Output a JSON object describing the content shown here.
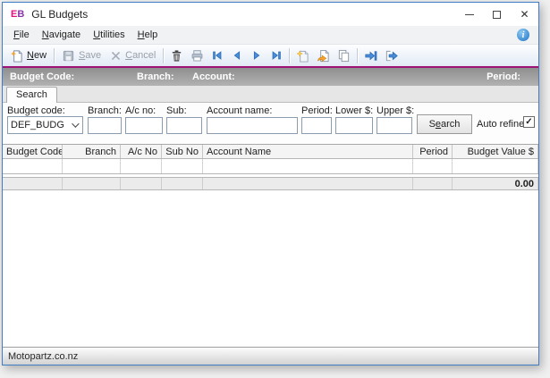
{
  "window": {
    "title": "GL Budgets",
    "logo_e": "E",
    "logo_b": "B"
  },
  "icons": {
    "close": "✕",
    "info": "i",
    "checkbox_check": "✓",
    "toolbar_icon_names": [
      "new-page",
      "save-disk",
      "cancel-x",
      "delete-trash",
      "print",
      "nav-first",
      "nav-previous",
      "nav-next",
      "nav-last",
      "new-line",
      "edit-line",
      "copy-pages",
      "import-arrow",
      "export-arrow"
    ]
  },
  "menu": {
    "items": [
      {
        "pre": "",
        "key": "F",
        "post": "ile"
      },
      {
        "pre": "",
        "key": "N",
        "post": "avigate"
      },
      {
        "pre": "",
        "key": "U",
        "post": "tilities"
      },
      {
        "pre": "",
        "key": "H",
        "post": "elp"
      }
    ]
  },
  "toolbar": {
    "new": {
      "pre": "",
      "key": "N",
      "post": "ew"
    },
    "save": {
      "pre": "",
      "key": "S",
      "post": "ave"
    },
    "cancel": {
      "pre": "",
      "key": "C",
      "post": "ancel"
    }
  },
  "header_band": {
    "budget_code": "Budget Code:",
    "branch": "Branch:",
    "account": "Account:",
    "period": "Period:"
  },
  "tabs": {
    "search": "Search"
  },
  "search_form": {
    "budget_code": {
      "label": "Budget code:",
      "value": "DEF_BUDG"
    },
    "branch": {
      "label": "Branch:",
      "value": ""
    },
    "ac_no": {
      "label": "A/c no:",
      "value": ""
    },
    "sub": {
      "label": "Sub:",
      "value": ""
    },
    "account_name": {
      "label": "Account name:",
      "value": ""
    },
    "period": {
      "label": "Period:",
      "value": ""
    },
    "lower": {
      "label": "Lower $:",
      "value": ""
    },
    "upper": {
      "label": "Upper $:",
      "value": ""
    },
    "search_button": {
      "pre": "S",
      "key": "e",
      "post": "arch"
    },
    "auto_refine": {
      "label": "Auto refine",
      "checked": true
    }
  },
  "grid": {
    "columns": [
      {
        "label": "Budget Code",
        "align": "left"
      },
      {
        "label": "Branch",
        "align": "right"
      },
      {
        "label": "A/c No",
        "align": "right"
      },
      {
        "label": "Sub No",
        "align": "right"
      },
      {
        "label": "Account Name",
        "align": "left"
      },
      {
        "label": "Period",
        "align": "right"
      },
      {
        "label": "Budget Value $",
        "align": "right"
      }
    ],
    "rows": [],
    "totals": {
      "budget_value": "0.00"
    }
  },
  "status_bar": {
    "text": "Motopartz.co.nz"
  },
  "colors": {
    "window_border": "#3f7ec2",
    "accent_magenta": "#9e1476",
    "logo_e": "#e50b7e",
    "logo_b": "#8a35a8",
    "nav_arrow_blue": "#4a8ede",
    "header_band_text": "#ffffff"
  }
}
